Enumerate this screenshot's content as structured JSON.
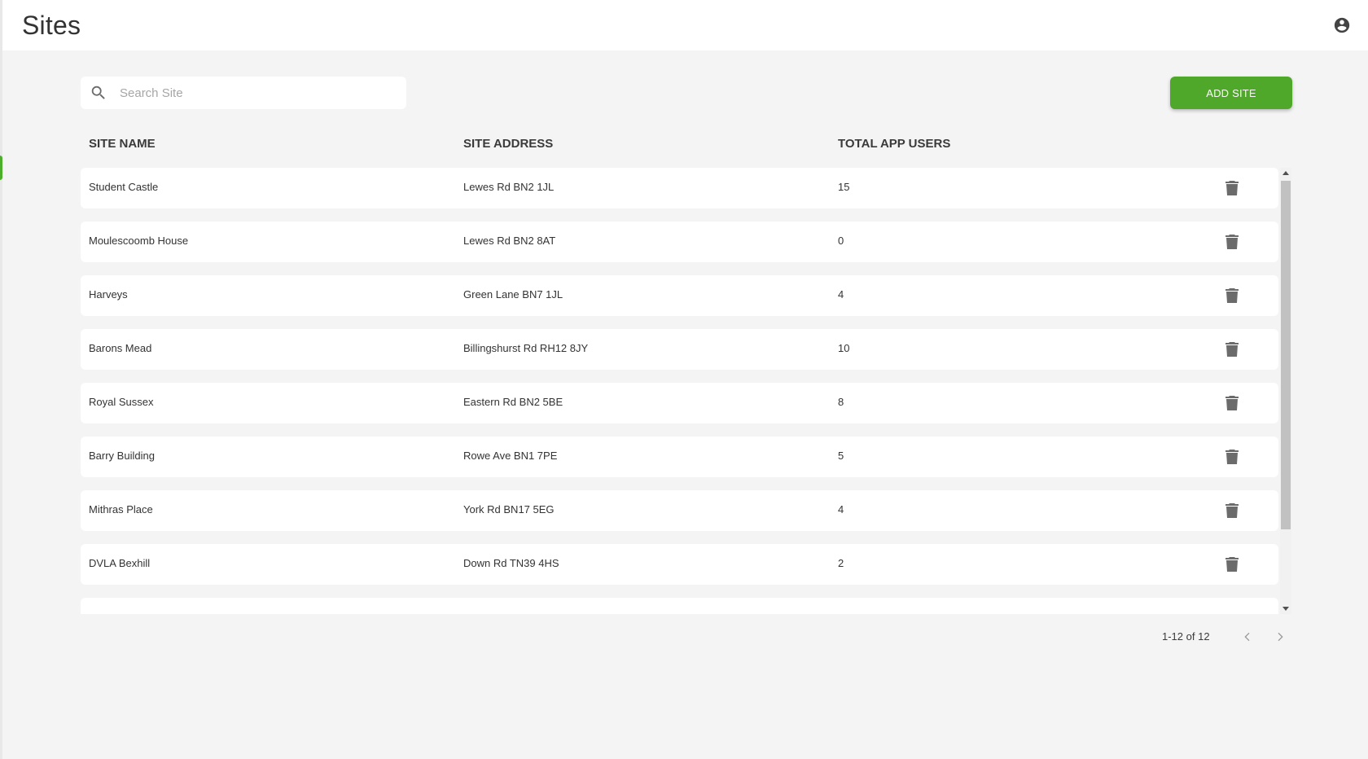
{
  "header": {
    "title": "Sites",
    "account_icon": "account-circle-icon"
  },
  "search": {
    "placeholder": "Search Site",
    "value": "",
    "icon": "search-icon"
  },
  "toolbar": {
    "add_label": "ADD SITE"
  },
  "table": {
    "columns": [
      "SITE NAME",
      "SITE ADDRESS",
      "TOTAL APP USERS"
    ],
    "rows": [
      {
        "name": "Student Castle",
        "address": "Lewes Rd BN2 1JL",
        "users": "15"
      },
      {
        "name": "Moulescoomb House",
        "address": "Lewes Rd BN2 8AT",
        "users": "0"
      },
      {
        "name": "Harveys",
        "address": "Green Lane BN7 1JL",
        "users": "4"
      },
      {
        "name": "Barons Mead",
        "address": "Billingshurst Rd RH12 8JY",
        "users": "10"
      },
      {
        "name": "Royal Sussex",
        "address": "Eastern Rd BN2 5BE",
        "users": "8"
      },
      {
        "name": "Barry Building",
        "address": "Rowe Ave BN1 7PE",
        "users": "5"
      },
      {
        "name": "Mithras Place",
        "address": "York Rd BN17 5EG",
        "users": "4"
      },
      {
        "name": "DVLA Bexhill",
        "address": "Down Rd TN39 4HS",
        "users": "2"
      }
    ],
    "row_action_icon": "trash-icon"
  },
  "pagination": {
    "range": "1-12 of 12",
    "prev_icon": "chevron-left-icon",
    "next_icon": "chevron-right-icon"
  },
  "colors": {
    "accent": "#4fa82a",
    "background": "#f4f4f4",
    "surface": "#ffffff",
    "icon": "#6b6b6b"
  }
}
